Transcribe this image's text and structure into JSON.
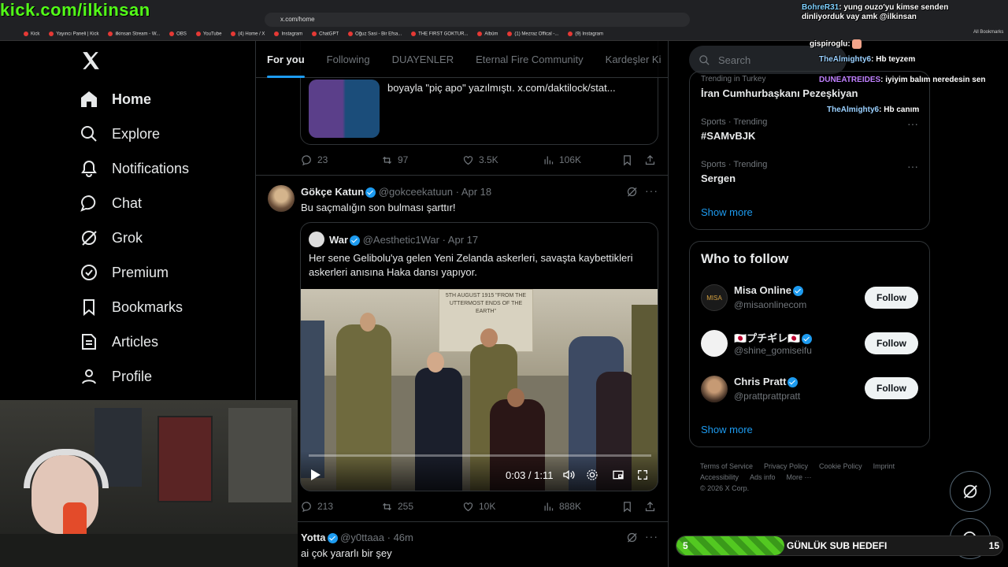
{
  "browser": {
    "url": "x.com/home",
    "bookmarks": [
      "Kick",
      "Yayıncı Paneli | Kick",
      "ilkinsan Stream - W...",
      "OBS",
      "YouTube",
      "(4) Home / X",
      "Instagram",
      "ChatGPT",
      "Oğuz Sasi - Bir Efsa...",
      "THE FIRST GOKTUR...",
      "Albüm",
      "(1) Mezraz Offical -...",
      "(9) Instagram"
    ],
    "all_bookmarks": "All Bookmarks"
  },
  "stream": {
    "kick_url": "kick.com/ilkinsan",
    "chat": [
      {
        "user": "BohreR31",
        "msg": "yung ouzo'yu kimse senden dinliyorduk vay amk @ilkinsan"
      },
      {
        "user": "gispiroglu",
        "msg": ""
      },
      {
        "user": "TheAlmighty6",
        "msg": "Hb teyzem"
      },
      {
        "user": "DUNEATREIDES",
        "msg": "iyiyim balım neredesin sen"
      },
      {
        "user": "TheAlmighty6",
        "msg": "Hb canım"
      }
    ],
    "sub_goal": {
      "current": "5",
      "label": "GÜNLÜK SUB HEDEFI",
      "target": "15",
      "progress": 0.33
    }
  },
  "nav": {
    "items": [
      {
        "label": "Home",
        "icon": "home-icon"
      },
      {
        "label": "Explore",
        "icon": "search-icon"
      },
      {
        "label": "Notifications",
        "icon": "bell-icon"
      },
      {
        "label": "Chat",
        "icon": "chat-bubble-icon"
      },
      {
        "label": "Grok",
        "icon": "grok-icon"
      },
      {
        "label": "Premium",
        "icon": "premium-badge-icon"
      },
      {
        "label": "Bookmarks",
        "icon": "bookmark-icon"
      },
      {
        "label": "Articles",
        "icon": "articles-icon"
      },
      {
        "label": "Profile",
        "icon": "person-icon"
      }
    ]
  },
  "tabs": [
    "For you",
    "Following",
    "DUAYENLER",
    "Eternal Fire Community",
    "Kardeşler Ki"
  ],
  "feed": {
    "tweet0": {
      "quote_text": "boyayla \"piç apo\" yazılmıştı.  x.com/daktilock/stat...",
      "replies": "23",
      "reposts": "97",
      "likes": "3.5K",
      "views": "106K"
    },
    "tweet1": {
      "name": "Gökçe Katun",
      "handle": "@gokceekatuun",
      "date": "· Apr 18",
      "text": "Bu saçmalığın son bulması şarttır!",
      "quote": {
        "name": "War",
        "handle": "@Aesthetic1War",
        "date": "· Apr 17",
        "text": "Her sene Gelibolu'ya gelen Yeni Zelanda askerleri, savaşta kaybettikleri askerleri anısına Haka dansı yapıyor.",
        "video_time": "0:03 / 1:11",
        "stone_text": "5TH AUGUST 1915 \"FROM THE UTTERMOST ENDS OF THE EARTH\""
      },
      "replies": "213",
      "reposts": "255",
      "likes": "10K",
      "views": "888K"
    },
    "tweet2": {
      "name": "Yotta",
      "handle": "@y0ttaaa",
      "date": "· 46m",
      "text": "ai çok yararlı bir şey"
    }
  },
  "right": {
    "search_placeholder": "Search",
    "trends": [
      {
        "meta": "Trending in Turkey",
        "title": "İran Cumhurbaşkanı Pezeşkiyan"
      },
      {
        "meta": "Sports · Trending",
        "title": "#SAMvBJK"
      },
      {
        "meta": "Sports · Trending",
        "title": "Sergen"
      }
    ],
    "trends_show_more": "Show more",
    "wtf_title": "Who to follow",
    "wtf": [
      {
        "name": "Misa Online",
        "handle": "@misaonlinecom",
        "avatar_text": "MISA"
      },
      {
        "name": "🇯🇵プチギレ🇯🇵",
        "handle": "@shine_gomiseifu",
        "avatar_text": ""
      },
      {
        "name": "Chris Pratt",
        "handle": "@prattprattpratt",
        "avatar_text": ""
      }
    ],
    "follow_label": "Follow",
    "wtf_show_more": "Show more",
    "footer": [
      "Terms of Service",
      "Privacy Policy",
      "Cookie Policy",
      "Imprint",
      "Accessibility",
      "Ads info",
      "More ···",
      "© 2026 X Corp."
    ]
  }
}
